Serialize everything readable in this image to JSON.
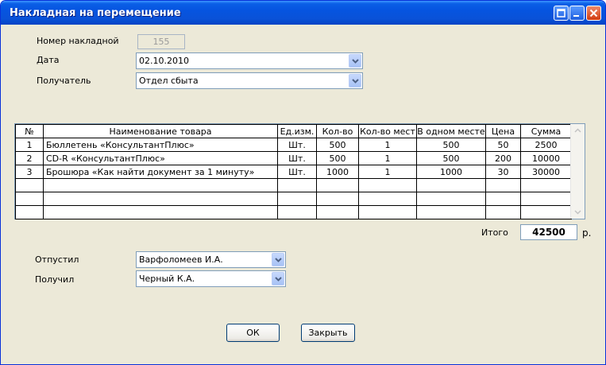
{
  "window": {
    "title": "Накладная на перемещение"
  },
  "form": {
    "invoice_number_label": "Номер накладной",
    "invoice_number_value": "155",
    "date_label": "Дата",
    "date_value": "02.10.2010",
    "recipient_label": "Получатель",
    "recipient_value": "Отдел сбыта"
  },
  "table": {
    "headers": [
      "№",
      "Наименование товара",
      "Ед.изм.",
      "Кол-во",
      "Кол-во мест",
      "В одном месте",
      "Цена",
      "Сумма"
    ],
    "rows": [
      [
        "1",
        "Бюллетень «КонсультантПлюс»",
        "Шт.",
        "500",
        "1",
        "500",
        "50",
        "2500"
      ],
      [
        "2",
        "CD-R «КонсультантПлюс»",
        "Шт.",
        "500",
        "1",
        "500",
        "200",
        "10000"
      ],
      [
        "3",
        "Брошюра «Как найти документ за 1 минуту»",
        "Шт.",
        "1000",
        "1",
        "1000",
        "30",
        "30000"
      ],
      [
        "",
        "",
        "",
        "",
        "",
        "",
        "",
        ""
      ],
      [
        "",
        "",
        "",
        "",
        "",
        "",
        "",
        ""
      ],
      [
        "",
        "",
        "",
        "",
        "",
        "",
        "",
        ""
      ]
    ]
  },
  "total": {
    "label": "Итого",
    "value": "42500",
    "currency": "р."
  },
  "signatures": {
    "released_label": "Отпустил",
    "released_value": "Варфоломеев И.А.",
    "received_label": "Получил",
    "received_value": "Черный К.А."
  },
  "buttons": {
    "ok_label": "ОК",
    "close_label": "Закрыть"
  },
  "icons": {
    "maximize": "maximize-icon",
    "minimize": "minimize-icon",
    "close": "close-icon",
    "dropdown": "chevron-down-icon",
    "scroll_up": "scroll-up-icon",
    "scroll_down": "scroll-down-icon"
  },
  "colors": {
    "titlebar": "#0654e0",
    "window_bg": "#ece9d8",
    "close_button": "#d23c10"
  }
}
